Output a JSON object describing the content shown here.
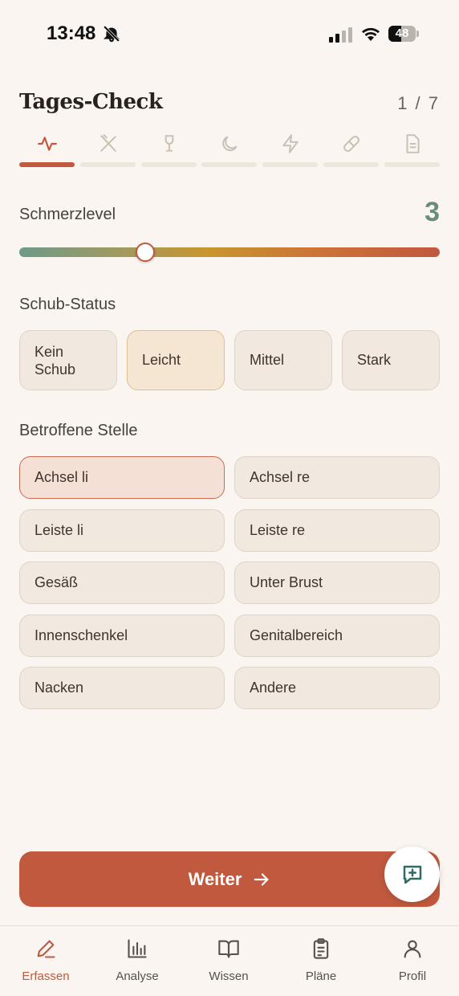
{
  "status_bar": {
    "time": "13:48",
    "battery": "48",
    "battery_level": 0.48
  },
  "header": {
    "title": "Tages-Check",
    "step_counter": "1 / 7"
  },
  "steps": [
    {
      "icon": "activity-icon",
      "active": true
    },
    {
      "icon": "utensils-icon",
      "active": false
    },
    {
      "icon": "wine-glass-icon",
      "active": false
    },
    {
      "icon": "moon-icon",
      "active": false
    },
    {
      "icon": "lightning-icon",
      "active": false
    },
    {
      "icon": "pill-icon",
      "active": false
    },
    {
      "icon": "document-icon",
      "active": false
    }
  ],
  "pain": {
    "label": "Schmerzlevel",
    "value": "3",
    "level": 3,
    "max": 10
  },
  "flare": {
    "label": "Schub-Status",
    "options": [
      "Kein\nSchub",
      "Leicht",
      "Mittel",
      "Stark"
    ],
    "selected": "Leicht"
  },
  "location": {
    "label": "Betroffene Stelle",
    "options": [
      "Achsel li",
      "Achsel re",
      "Leiste li",
      "Leiste re",
      "Gesäß",
      "Unter Brust",
      "Innenschenkel",
      "Genitalbereich",
      "Nacken",
      "Andere"
    ],
    "selected": "Achsel li"
  },
  "primary_button": {
    "label": "Weiter"
  },
  "tabbar": {
    "tabs": [
      {
        "label": "Erfassen",
        "icon": "pencil-icon",
        "active": true
      },
      {
        "label": "Analyse",
        "icon": "bar-chart-icon",
        "active": false
      },
      {
        "label": "Wissen",
        "icon": "book-icon",
        "active": false
      },
      {
        "label": "Pläne",
        "icon": "clipboard-icon",
        "active": false
      },
      {
        "label": "Profil",
        "icon": "user-icon",
        "active": false
      }
    ]
  },
  "colors": {
    "accent": "#c0593e",
    "green": "#6b8c76",
    "background": "#faf5f0"
  }
}
